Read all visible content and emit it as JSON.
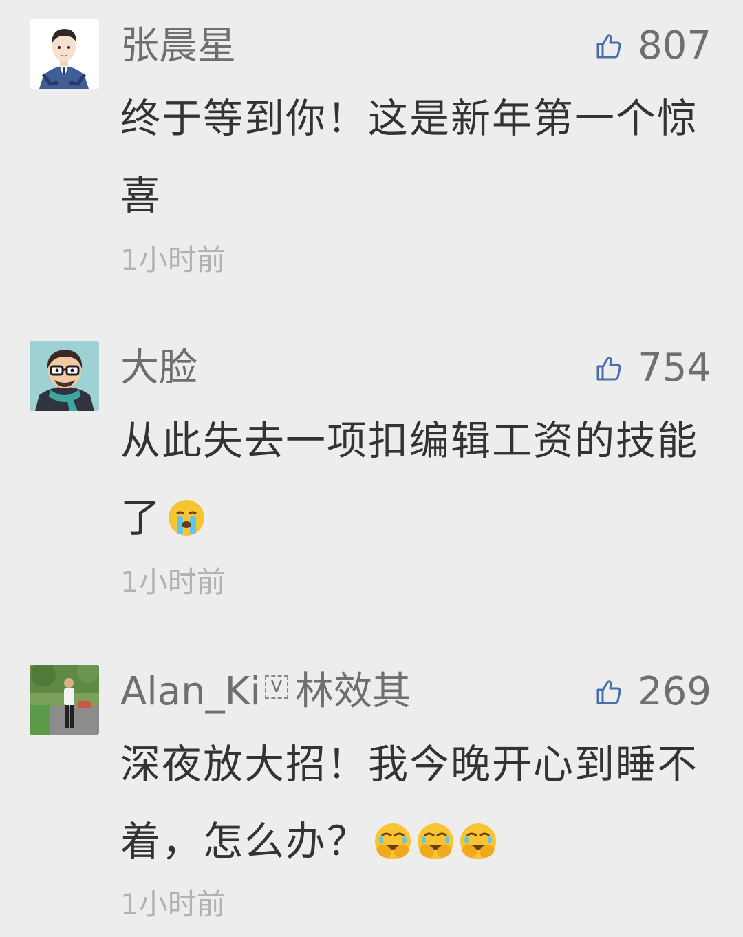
{
  "comments": [
    {
      "author": "张晨星",
      "likes": "807",
      "content": "终于等到你！这是新年第一个惊喜",
      "time": "1小时前",
      "avatar": "avatar-man-in-suit"
    },
    {
      "author": "大脸",
      "likes": "754",
      "content": "从此失去一项扣编辑工资的技能了",
      "emoji": "crying-face",
      "time": "1小时前",
      "avatar": "avatar-man-with-glasses-scarf"
    },
    {
      "author": "Alan_Ki",
      "verified_mark": "V",
      "author_cn": "林效其",
      "likes": "269",
      "content": "深夜放大招！我今晚开心到睡不着，怎么办？",
      "emojis": [
        "facepalm-face",
        "facepalm-face",
        "facepalm-face"
      ],
      "time": "1小时前",
      "avatar": "avatar-photo-man-walking"
    }
  ],
  "colors": {
    "background": "#ededed",
    "name": "#6f6f6f",
    "content": "#333333",
    "time": "#b2b2b2",
    "like_icon": "#4a6ea9"
  }
}
